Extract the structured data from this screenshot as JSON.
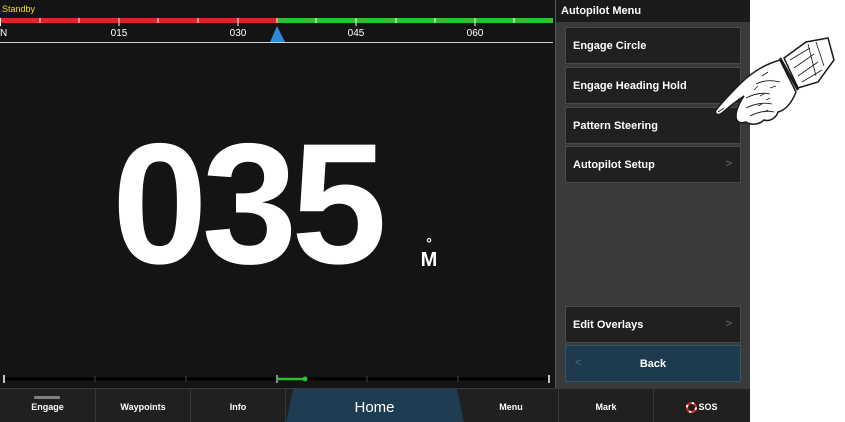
{
  "status": {
    "mode": "Standby"
  },
  "compass": {
    "ticks": [
      {
        "label": "N",
        "value": 0
      },
      {
        "label": "015",
        "value": 15
      },
      {
        "label": "030",
        "value": 30
      },
      {
        "label": "045",
        "value": 45
      },
      {
        "label": "060",
        "value": 60
      }
    ],
    "pointer_heading": 35,
    "port_bar_color": "#d62828",
    "starboard_bar_color": "#27c427",
    "pointer_color": "#2e86d6"
  },
  "heading": {
    "value": "035",
    "degree_symbol": "°",
    "reference": "M"
  },
  "rudder": {
    "indicator_color": "#27c427"
  },
  "menu": {
    "title": "Autopilot Menu",
    "items": [
      {
        "label": "Engage Circle",
        "chevron": ""
      },
      {
        "label": "Engage Heading Hold",
        "chevron": ""
      },
      {
        "label": "Pattern Steering",
        "chevron": ""
      },
      {
        "label": "Autopilot Setup",
        "chevron": ">"
      }
    ],
    "overlay_item": {
      "label": "Edit Overlays",
      "chevron": ">"
    },
    "back": {
      "label": "Back",
      "chevron": "<"
    }
  },
  "softkeys": [
    {
      "label": "Engage"
    },
    {
      "label": "Waypoints"
    },
    {
      "label": "Info"
    },
    {
      "label": "Home"
    },
    {
      "label": "Menu"
    },
    {
      "label": "Mark"
    },
    {
      "label": "SOS"
    }
  ],
  "graphic": {
    "icon": "pointing-hand-icon"
  }
}
